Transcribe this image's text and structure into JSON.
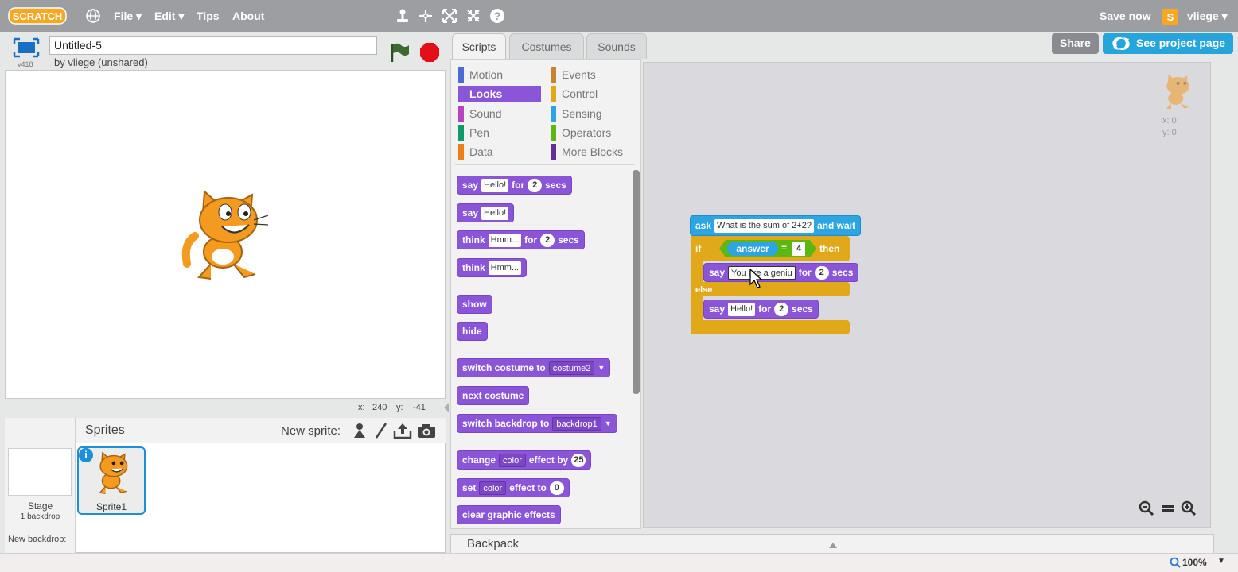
{
  "menubar": {
    "logo": "SCRATCH",
    "file": "File ▾",
    "edit": "Edit ▾",
    "tips": "Tips",
    "about": "About",
    "save_now": "Save now",
    "user": "vliege ▾"
  },
  "project": {
    "version": "v418",
    "title": "Untitled-5",
    "byline": "by vliege (unshared)"
  },
  "stage_coords": {
    "x_label": "x:",
    "x": "240",
    "y_label": "y:",
    "y": "-41"
  },
  "sprites": {
    "header": "Sprites",
    "new_sprite_label": "New sprite:",
    "stage_label": "Stage",
    "stage_sub": "1 backdrop",
    "new_backdrop": "New backdrop:",
    "sprite1": "Sprite1"
  },
  "tabs": {
    "scripts": "Scripts",
    "costumes": "Costumes",
    "sounds": "Sounds"
  },
  "categories": {
    "motion": "Motion",
    "looks": "Looks",
    "sound": "Sound",
    "pen": "Pen",
    "data": "Data",
    "events": "Events",
    "control": "Control",
    "sensing": "Sensing",
    "operators": "Operators",
    "more": "More Blocks"
  },
  "palette_blocks": {
    "say_for": {
      "a": "say",
      "t": "Hello!",
      "b": "for",
      "n": "2",
      "c": "secs"
    },
    "say": {
      "a": "say",
      "t": "Hello!"
    },
    "think_for": {
      "a": "think",
      "t": "Hmm...",
      "b": "for",
      "n": "2",
      "c": "secs"
    },
    "think": {
      "a": "think",
      "t": "Hmm..."
    },
    "show": "show",
    "hide": "hide",
    "switch_costume": {
      "a": "switch costume to",
      "d": "costume2"
    },
    "next_costume": "next costume",
    "switch_backdrop": {
      "a": "switch backdrop to",
      "d": "backdrop1"
    },
    "change_effect": {
      "a": "change",
      "d": "color",
      "b": "effect by",
      "n": "25"
    },
    "set_effect": {
      "a": "set",
      "d": "color",
      "b": "effect to",
      "n": "0"
    },
    "clear_effects": "clear graphic effects"
  },
  "script": {
    "ask": {
      "a": "ask",
      "t": "What is the sum of 2+2?",
      "b": "and wait"
    },
    "if_kw": "if",
    "answer": "answer",
    "eq": "=",
    "eq_val": "4",
    "then": "then",
    "say1": {
      "a": "say",
      "t": "You are a geniu",
      "b": "for",
      "n": "2",
      "c": "secs"
    },
    "else": "else",
    "say2": {
      "a": "say",
      "t": "Hello!",
      "b": "for",
      "n": "2",
      "c": "secs"
    }
  },
  "sprite_info": {
    "x": "x: 0",
    "y": "y: 0"
  },
  "buttons": {
    "share": "Share",
    "see_project": "See project page"
  },
  "backpack": "Backpack",
  "zoom": "100%",
  "colors": {
    "looks": "#8a55d7",
    "control": "#e1a91a",
    "sensing": "#2ca5e2",
    "operators": "#5cb712",
    "share": "#8a8b90",
    "see_project": "#25a5dc"
  }
}
